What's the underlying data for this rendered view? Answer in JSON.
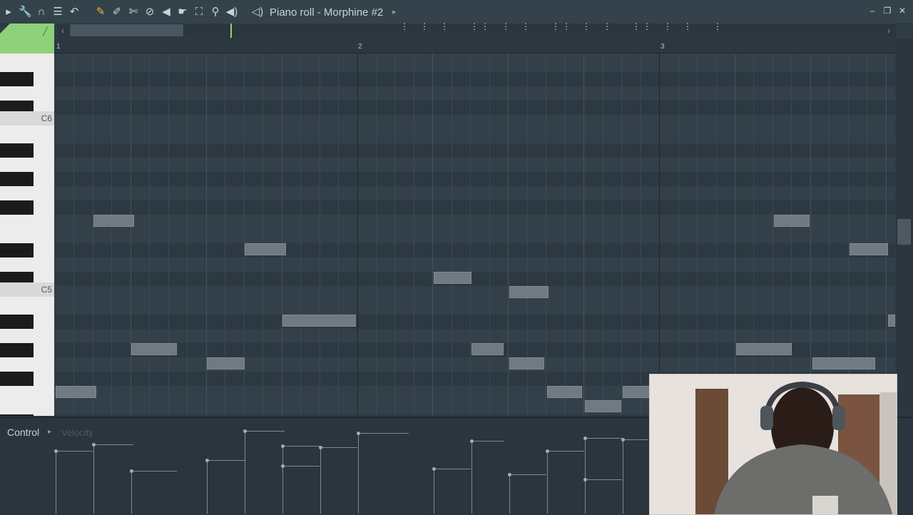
{
  "titlebar": {
    "title": "Piano roll - Morphine #2"
  },
  "toolbar": {
    "icons": [
      "play-arrow-icon",
      "wrench-icon",
      "magnet-icon",
      "menu-icon",
      "undo-icon",
      "pencil-icon",
      "paint-brush-icon",
      "delete-tool-icon",
      "mute-tool-icon",
      "slice-tool-icon",
      "select-tool-icon",
      "zoom-tool-icon",
      "playback-tool-icon",
      "speaker-icon"
    ]
  },
  "ruler": {
    "bars": [
      "1",
      "2",
      "3"
    ]
  },
  "keyboard": {
    "labels": [
      "C6",
      "C5"
    ]
  },
  "control": {
    "label": "Control",
    "target": "Velocity"
  },
  "notes": [],
  "colors": {
    "snap_green": "#8fd07a",
    "grid": "#33404a",
    "note": "#6f7a81"
  }
}
